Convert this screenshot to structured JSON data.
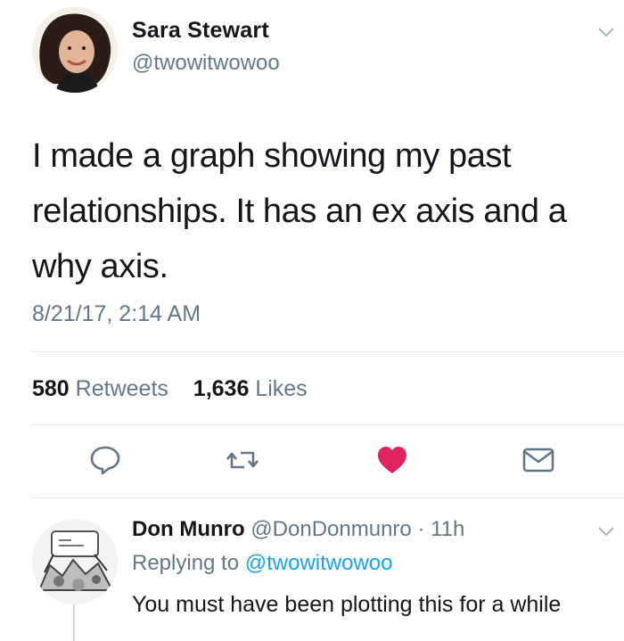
{
  "tweet": {
    "author_name": "Sara Stewart",
    "author_handle": "@twowitwowoo",
    "text_line1": "I made a graph showing my past",
    "text_line2": "relationships. It has an ex axis and a",
    "text_line3": "why axis.",
    "timestamp": "8/21/17, 2:14 AM",
    "retweets_count": "580",
    "retweets_label": "Retweets",
    "likes_count": "1,636",
    "likes_label": "Likes",
    "liked": true
  },
  "reply": {
    "author_name": "Don Munro",
    "author_handle": "@DonDonmunro",
    "separator": "·",
    "time_ago": "11h",
    "replying_prefix": "Replying to",
    "replying_handle": "@twowitwowoo",
    "text": "You must have been plotting this for a while"
  },
  "icons": {
    "reply": "reply-icon",
    "retweet": "retweet-icon",
    "like": "heart-icon",
    "dm": "envelope-icon",
    "more": "chevron-down-icon"
  },
  "colors": {
    "text": "#14171a",
    "secondary": "#657786",
    "link": "#1da1f2",
    "like": "#e0245e",
    "divider": "#e1e8ed"
  }
}
